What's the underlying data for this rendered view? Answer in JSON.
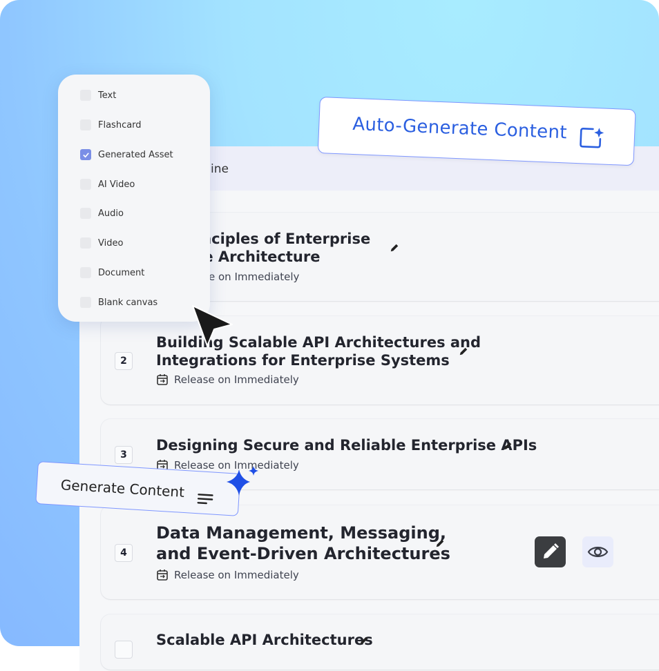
{
  "panel": {
    "title": "ine"
  },
  "options": [
    {
      "label": "Text",
      "checked": false
    },
    {
      "label": "Flashcard",
      "checked": false
    },
    {
      "label": "Generated Asset",
      "checked": true
    },
    {
      "label": "AI Video",
      "checked": false
    },
    {
      "label": "Audio",
      "checked": false
    },
    {
      "label": "Video",
      "checked": false
    },
    {
      "label": "Document",
      "checked": false
    },
    {
      "label": "Blank canvas",
      "checked": false
    }
  ],
  "lessons": [
    {
      "num": "",
      "title_line1": "inciples of Enterprise",
      "title_line2": "re Architecture",
      "release": "e on Immediately"
    },
    {
      "num": "2",
      "title_line1": "Building Scalable API Architectures and",
      "title_line2": "Integrations for Enterprise Systems",
      "release": "Release on Immediately"
    },
    {
      "num": "3",
      "title_line1": "Designing Secure and Reliable Enterprise APIs",
      "release": "Release on Immediately"
    },
    {
      "num": "4",
      "title_line1": "Data Management, Messaging,",
      "title_line2": "and Event-Driven Architectures",
      "release": "Release on Immediately"
    },
    {
      "num": "",
      "title_line1": "Scalable API Architectures"
    }
  ],
  "auto_generate": {
    "label": "Auto-Generate Content",
    "icon": "sparkle-frame-icon"
  },
  "generate": {
    "label": "Generate Content",
    "icon": "lines-icon"
  },
  "colors": {
    "accent": "#2b5fe0",
    "border_accent": "#7e96ff",
    "check_on": "#7a8ee6"
  }
}
